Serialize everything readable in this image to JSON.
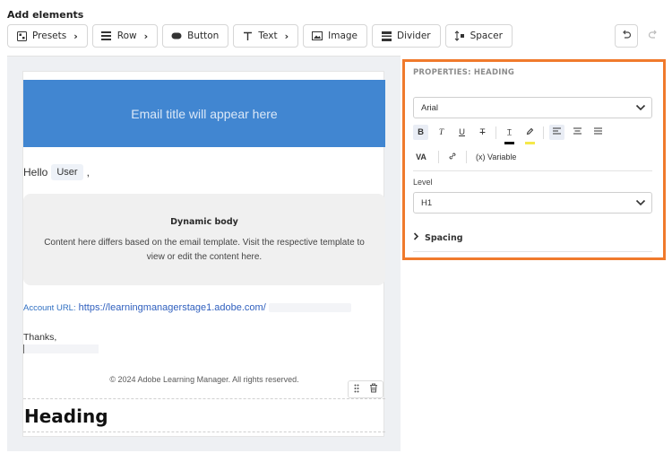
{
  "toolbar": {
    "title": "Add elements",
    "buttons": [
      {
        "label": "Presets",
        "icon": "presets-icon",
        "chevron": true
      },
      {
        "label": "Row",
        "icon": "row-icon",
        "chevron": true
      },
      {
        "label": "Button",
        "icon": "button-icon",
        "chevron": false
      },
      {
        "label": "Text",
        "icon": "text-icon",
        "chevron": true
      },
      {
        "label": "Image",
        "icon": "image-icon",
        "chevron": false
      },
      {
        "label": "Divider",
        "icon": "divider-icon",
        "chevron": false
      },
      {
        "label": "Spacer",
        "icon": "spacer-icon",
        "chevron": false
      }
    ]
  },
  "email": {
    "header_text": "Email title will appear here",
    "greeting": "Hello",
    "user_tag": "User",
    "greeting_suffix": ",",
    "dynamic_title": "Dynamic body",
    "dynamic_desc": "Content here differs based on the email template. Visit the respective template to view or edit the content here.",
    "account_label": "Account URL:",
    "account_url": "https://learningmanagerstage1.adobe.com/",
    "thanks": "Thanks,",
    "copyright": "© 2024 Adobe Learning Manager. All rights reserved.",
    "heading": "Heading"
  },
  "properties": {
    "title": "PROPERTIES: HEADING",
    "font_value": "Arial",
    "variable_label": "(x) Variable",
    "va_label": "VA",
    "level_label": "Level",
    "level_value": "H1",
    "spacing_label": "Spacing"
  },
  "colors": {
    "accent_border": "#f07a2c",
    "header_bg": "#4186d1",
    "text_color_swatch": "#111111",
    "highlight_swatch": "#f5e84a"
  }
}
